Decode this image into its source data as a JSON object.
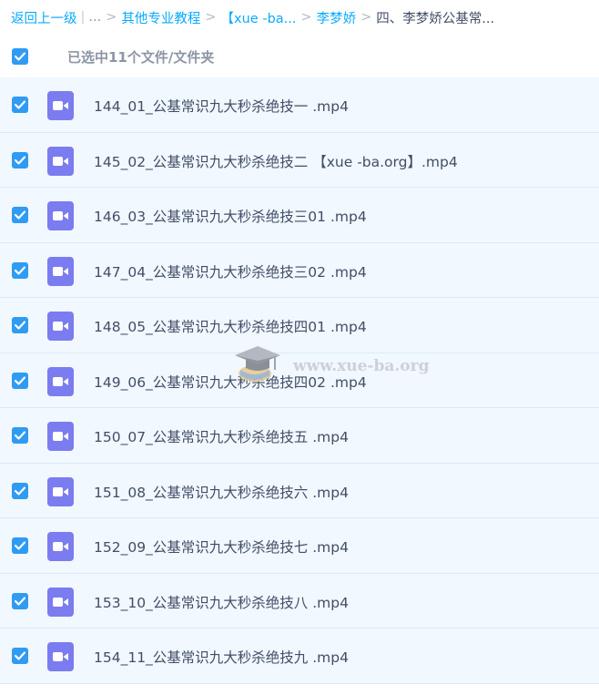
{
  "breadcrumb": {
    "back": "返回上一级",
    "ellipsis": "...",
    "items": [
      "其他专业教程",
      "【xue -ba...",
      "李梦娇"
    ],
    "current": "四、李梦娇公基常..."
  },
  "selection": {
    "label": "已选中11个文件/文件夹",
    "checked": true
  },
  "files": [
    {
      "name": "144_01_公基常识九大秒杀绝技一 .mp4",
      "checked": true,
      "icon": "video-file-icon"
    },
    {
      "name": "145_02_公基常识九大秒杀绝技二 【xue -ba.org】.mp4",
      "checked": true,
      "icon": "video-file-icon"
    },
    {
      "name": "146_03_公基常识九大秒杀绝技三01 .mp4",
      "checked": true,
      "icon": "video-file-icon"
    },
    {
      "name": "147_04_公基常识九大秒杀绝技三02 .mp4",
      "checked": true,
      "icon": "video-file-icon"
    },
    {
      "name": "148_05_公基常识九大秒杀绝技四01 .mp4",
      "checked": true,
      "icon": "video-file-icon"
    },
    {
      "name": "149_06_公基常识九大秒杀绝技四02 .mp4",
      "checked": true,
      "icon": "video-file-icon"
    },
    {
      "name": "150_07_公基常识九大秒杀绝技五 .mp4",
      "checked": true,
      "icon": "video-file-icon"
    },
    {
      "name": "151_08_公基常识九大秒杀绝技六 .mp4",
      "checked": true,
      "icon": "video-file-icon"
    },
    {
      "name": "152_09_公基常识九大秒杀绝技七 .mp4",
      "checked": true,
      "icon": "video-file-icon"
    },
    {
      "name": "153_10_公基常识九大秒杀绝技八 .mp4",
      "checked": true,
      "icon": "video-file-icon"
    },
    {
      "name": "154_11_公基常识九大秒杀绝技九 .mp4",
      "checked": true,
      "icon": "video-file-icon"
    }
  ],
  "watermark": {
    "text": "www.xue-ba.org",
    "icon": "graduation-cap-icon"
  },
  "colors": {
    "link": "#09aaff",
    "checkbox": "#2f9bf2",
    "video_icon": "#7b7cf0",
    "row_bg": "#f1f8ff",
    "text": "#424e67"
  }
}
